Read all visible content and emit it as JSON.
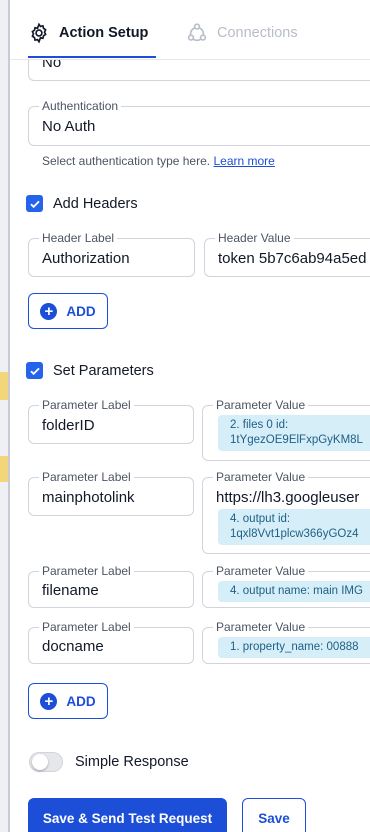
{
  "tabs": {
    "action_setup": "Action Setup",
    "connections": "Connections"
  },
  "top_field": {
    "value": "No"
  },
  "authentication": {
    "label": "Authentication",
    "value": "No Auth",
    "helper": "Select authentication type here.",
    "helper_link": "Learn more"
  },
  "headers": {
    "checkbox_label": "Add Headers",
    "checked": true,
    "label_field_label": "Header Label",
    "value_field_label": "Header Value",
    "rows": [
      {
        "label": "Authorization",
        "value": "token 5b7c6ab94a5ed"
      }
    ],
    "add_label": "ADD"
  },
  "parameters": {
    "checkbox_label": "Set Parameters",
    "checked": true,
    "label_field_label": "Parameter Label",
    "value_field_label": "Parameter Value",
    "rows": [
      {
        "label": "folderID",
        "text": "",
        "chip": "2. files 0 id:\n1tYgezOE9ElFxpGyKM8L"
      },
      {
        "label": "mainphotolink",
        "text": "https://lh3.googleuser",
        "chip": "4. output id:\n1qxl8Vvt1plcw366yGOz4"
      },
      {
        "label": "filename",
        "text": "",
        "chip": "4. output name: main IMG"
      },
      {
        "label": "docname",
        "text": "",
        "chip": "1. property_name: 00888"
      }
    ],
    "add_label": "ADD"
  },
  "simple_response": {
    "label": "Simple Response",
    "on": false
  },
  "actions": {
    "primary": "Save & Send Test Request",
    "secondary": "Save"
  },
  "colors": {
    "accent": "#1d4ed8",
    "chip_bg": "#d6eef8",
    "chip_text": "#1e5f86"
  }
}
